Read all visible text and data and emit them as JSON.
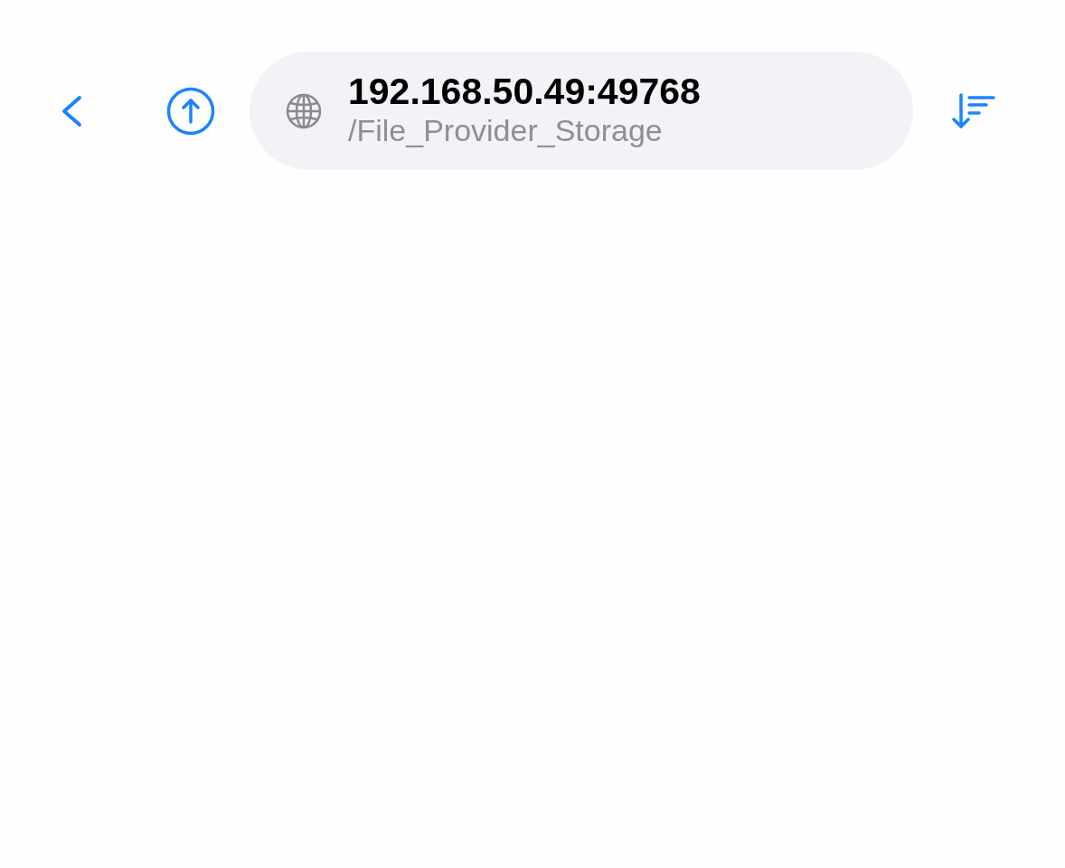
{
  "address_bar": {
    "host": "192.168.50.49:49768",
    "path": "/File_Provider_Storage"
  }
}
